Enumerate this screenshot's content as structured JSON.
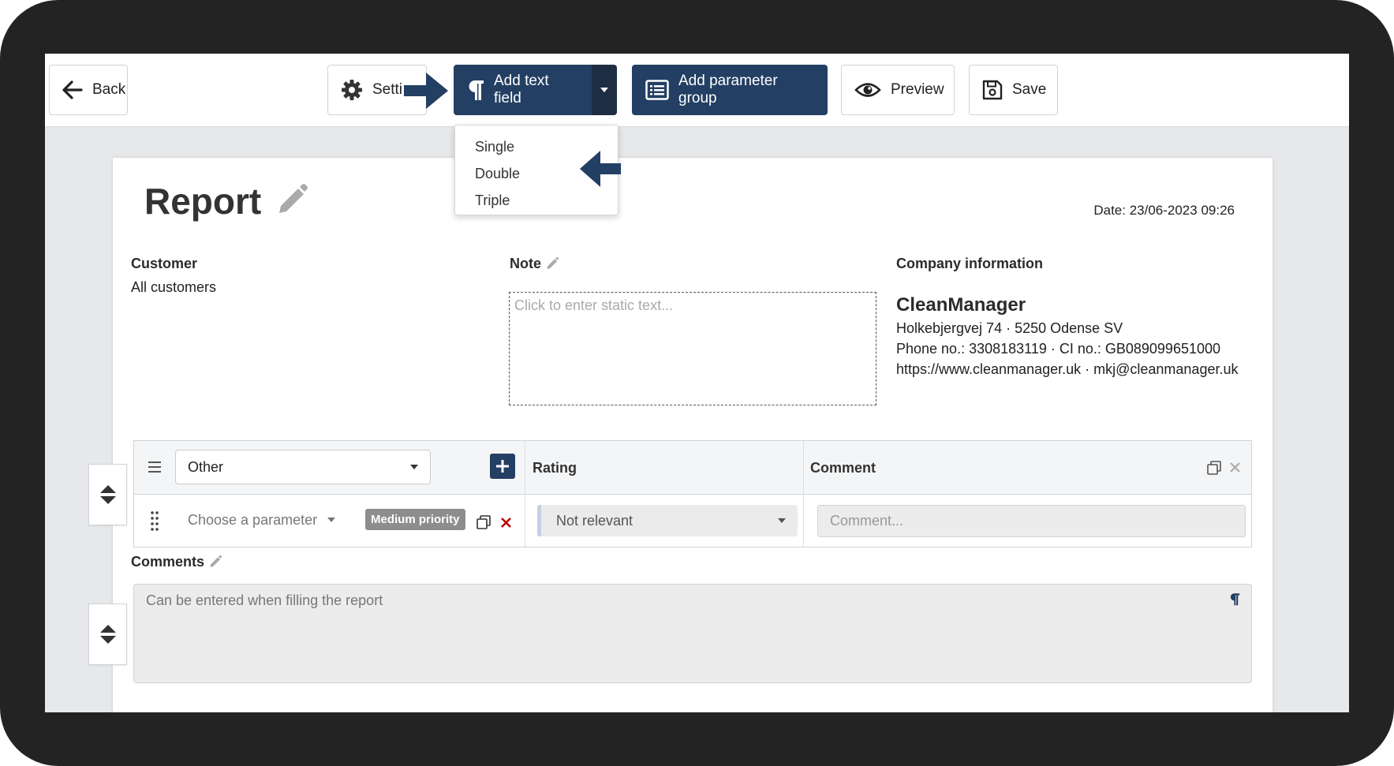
{
  "toolbar": {
    "back": {
      "label": "Back",
      "icon": "arrow-left-icon"
    },
    "settings": {
      "label": "Setti",
      "icon": "gear-icon"
    },
    "add_text_field": {
      "label": "Add text field",
      "icon": "paragraph-icon"
    },
    "add_parameter_group": {
      "label": "Add parameter group",
      "icon": "list-icon"
    },
    "preview": {
      "label": "Preview",
      "icon": "eye-icon"
    },
    "save": {
      "label": "Save",
      "icon": "floppy-icon"
    }
  },
  "text_field_menu": {
    "options": [
      "Single",
      "Double",
      "Triple"
    ]
  },
  "report": {
    "title": "Report",
    "date": "Date: 23/06-2023 09:26",
    "customer": {
      "label": "Customer",
      "value": "All customers"
    },
    "note": {
      "label": "Note",
      "placeholder": "Click to enter static text..."
    },
    "company": {
      "label": "Company information",
      "name": "CleanManager",
      "address": "Holkebjergvej 74 · 5250 Odense SV",
      "phone": "Phone no.: 3308183119 · CI no.: GB089099651000",
      "web": "https://www.cleanmanager.uk · mkj@cleanmanager.uk"
    },
    "parameter_table": {
      "category": "Other",
      "headers": {
        "rating": "Rating",
        "comment": "Comment"
      },
      "row": {
        "parameter_placeholder": "Choose a parameter",
        "priority": "Medium priority",
        "rating": "Not relevant",
        "comment_placeholder": "Comment..."
      }
    },
    "comments": {
      "label": "Comments",
      "placeholder": "Can be entered when filling the report"
    }
  },
  "colors": {
    "primary": "#233f63",
    "frame": "#232323",
    "delete": "#c00000",
    "badge": "#8d8d8d"
  }
}
